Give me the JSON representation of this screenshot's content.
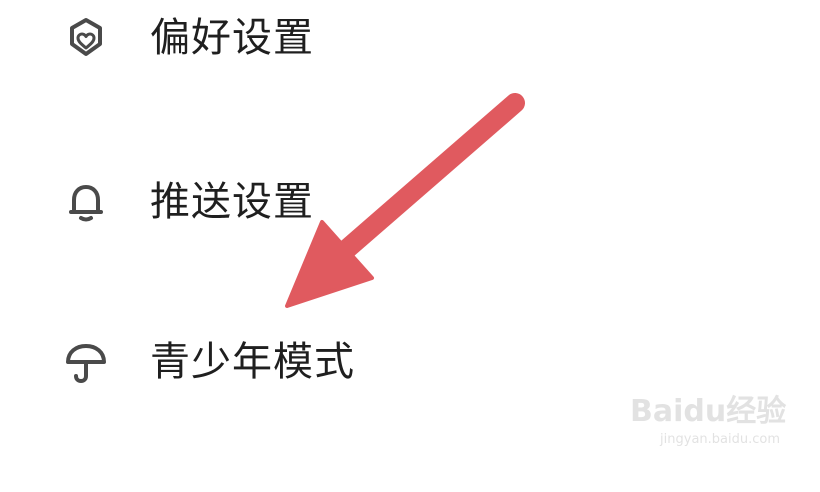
{
  "menu": {
    "items": [
      {
        "label": "偏好设置",
        "icon": "preference-shield-heart-icon"
      },
      {
        "label": "推送设置",
        "icon": "bell-icon"
      },
      {
        "label": "青少年模式",
        "icon": "umbrella-icon"
      }
    ]
  },
  "annotation": {
    "arrow_color": "#e05a5f"
  },
  "watermark": {
    "logo_text": "Baidu经验",
    "url": "jingyan.baidu.com"
  },
  "colors": {
    "text": "#1f1f1f",
    "icon": "#4a4a4a",
    "background": "#ffffff"
  }
}
